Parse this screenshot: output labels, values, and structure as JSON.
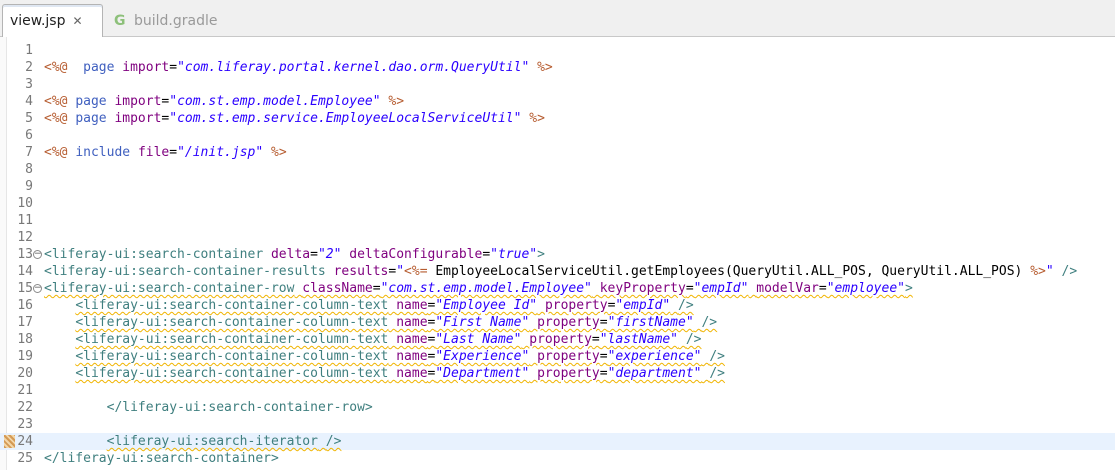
{
  "tabs": [
    {
      "label": "view.jsp",
      "close": "✕",
      "active": true
    },
    {
      "label": "build.gradle",
      "icon": "G",
      "active": false
    }
  ],
  "current_line": 24,
  "colors": {
    "directive": "#b65c30",
    "keyword": "#3f5fbf",
    "tag": "#3f7f7f",
    "attribute": "#7f007f",
    "value": "#2a00ff",
    "current_line_bg": "#e8f2fe",
    "warning_underline": "#f0b400"
  },
  "lines": [
    {
      "n": 1,
      "tokens": []
    },
    {
      "n": 2,
      "tokens": [
        [
          "dir",
          "<%@"
        ],
        [
          "",
          "  "
        ],
        [
          "kw",
          "page"
        ],
        [
          "",
          " "
        ],
        [
          "attr",
          "import"
        ],
        [
          "",
          "="
        ],
        [
          "val",
          "\"com.liferay.portal.kernel.dao.orm.QueryUtil\""
        ],
        [
          "",
          " "
        ],
        [
          "dir",
          "%>"
        ]
      ]
    },
    {
      "n": 3,
      "tokens": []
    },
    {
      "n": 4,
      "tokens": [
        [
          "dir",
          "<%@"
        ],
        [
          "",
          " "
        ],
        [
          "kw",
          "page"
        ],
        [
          "",
          " "
        ],
        [
          "attr",
          "import"
        ],
        [
          "",
          "="
        ],
        [
          "val",
          "\"com.st.emp.model.Employee\""
        ],
        [
          "",
          " "
        ],
        [
          "dir",
          "%>"
        ]
      ]
    },
    {
      "n": 5,
      "tokens": [
        [
          "dir",
          "<%@"
        ],
        [
          "",
          " "
        ],
        [
          "kw",
          "page"
        ],
        [
          "",
          " "
        ],
        [
          "attr",
          "import"
        ],
        [
          "",
          "="
        ],
        [
          "val",
          "\"com.st.emp.service.EmployeeLocalServiceUtil\""
        ],
        [
          "",
          " "
        ],
        [
          "dir",
          "%>"
        ]
      ]
    },
    {
      "n": 6,
      "tokens": []
    },
    {
      "n": 7,
      "tokens": [
        [
          "dir",
          "<%@"
        ],
        [
          "",
          " "
        ],
        [
          "kw",
          "include"
        ],
        [
          "",
          " "
        ],
        [
          "attr",
          "file"
        ],
        [
          "",
          "="
        ],
        [
          "val",
          "\"/init.jsp\""
        ],
        [
          "",
          " "
        ],
        [
          "dir",
          "%>"
        ]
      ]
    },
    {
      "n": 8,
      "tokens": []
    },
    {
      "n": 9,
      "tokens": []
    },
    {
      "n": 10,
      "tokens": []
    },
    {
      "n": 11,
      "tokens": []
    },
    {
      "n": 12,
      "tokens": []
    },
    {
      "n": 13,
      "fold": true,
      "tokens": [
        [
          "tag",
          "<liferay-ui:search-container"
        ],
        [
          "",
          " "
        ],
        [
          "attr",
          "delta"
        ],
        [
          "",
          "="
        ],
        [
          "val",
          "\"2\""
        ],
        [
          "",
          " "
        ],
        [
          "attr",
          "deltaConfigurable"
        ],
        [
          "",
          "="
        ],
        [
          "val",
          "\"true\""
        ],
        [
          "tag",
          ">"
        ]
      ]
    },
    {
      "n": 14,
      "tokens": [
        [
          "tag",
          "<liferay-ui:search-container-results"
        ],
        [
          "",
          " "
        ],
        [
          "attr",
          "results"
        ],
        [
          "",
          "="
        ],
        [
          "val",
          "\""
        ],
        [
          "dir",
          "<%="
        ],
        [
          "java",
          " EmployeeLocalServiceUtil.getEmployees(QueryUtil.ALL_POS, QueryUtil.ALL_POS) "
        ],
        [
          "dir",
          "%>"
        ],
        [
          "val",
          "\""
        ],
        [
          "",
          " "
        ],
        [
          "tag",
          "/>"
        ]
      ]
    },
    {
      "n": 15,
      "fold": true,
      "warn": true,
      "tokens": [
        [
          "tag",
          "<liferay-ui:search-container-row"
        ],
        [
          "",
          " "
        ],
        [
          "attr",
          "className"
        ],
        [
          "",
          "="
        ],
        [
          "val",
          "\"com.st.emp.model.Employee\""
        ],
        [
          "",
          " "
        ],
        [
          "attr",
          "keyProperty"
        ],
        [
          "",
          "="
        ],
        [
          "val",
          "\"empId\""
        ],
        [
          "",
          " "
        ],
        [
          "attr",
          "modelVar"
        ],
        [
          "",
          "="
        ],
        [
          "val",
          "\"employee\""
        ],
        [
          "tag",
          ">"
        ]
      ]
    },
    {
      "n": 16,
      "warn": true,
      "tokens": [
        [
          "",
          "    "
        ],
        [
          "tag",
          "<liferay-ui:search-container-column-text"
        ],
        [
          "",
          " "
        ],
        [
          "attr",
          "name"
        ],
        [
          "",
          "="
        ],
        [
          "val",
          "\"Employee Id\""
        ],
        [
          "",
          " "
        ],
        [
          "attr",
          "property"
        ],
        [
          "",
          "="
        ],
        [
          "val",
          "\"empId\""
        ],
        [
          "",
          " "
        ],
        [
          "tag",
          "/>"
        ]
      ]
    },
    {
      "n": 17,
      "warn": true,
      "tokens": [
        [
          "",
          "    "
        ],
        [
          "tag",
          "<liferay-ui:search-container-column-text"
        ],
        [
          "",
          " "
        ],
        [
          "attr",
          "name"
        ],
        [
          "",
          "="
        ],
        [
          "val",
          "\"First Name\""
        ],
        [
          "",
          " "
        ],
        [
          "attr",
          "property"
        ],
        [
          "",
          "="
        ],
        [
          "val",
          "\"firstName\""
        ],
        [
          "",
          " "
        ],
        [
          "tag",
          "/>"
        ]
      ]
    },
    {
      "n": 18,
      "warn": true,
      "tokens": [
        [
          "",
          "    "
        ],
        [
          "tag",
          "<liferay-ui:search-container-column-text"
        ],
        [
          "",
          " "
        ],
        [
          "attr",
          "name"
        ],
        [
          "",
          "="
        ],
        [
          "val",
          "\"Last Name\""
        ],
        [
          "",
          " "
        ],
        [
          "attr",
          "property"
        ],
        [
          "",
          "="
        ],
        [
          "val",
          "\"lastName\""
        ],
        [
          "",
          " "
        ],
        [
          "tag",
          "/>"
        ]
      ]
    },
    {
      "n": 19,
      "warn": true,
      "tokens": [
        [
          "",
          "    "
        ],
        [
          "tag",
          "<liferay-ui:search-container-column-text"
        ],
        [
          "",
          " "
        ],
        [
          "attr",
          "name"
        ],
        [
          "",
          "="
        ],
        [
          "val",
          "\"Experience\""
        ],
        [
          "",
          " "
        ],
        [
          "attr",
          "property"
        ],
        [
          "",
          "="
        ],
        [
          "val",
          "\"experience\""
        ],
        [
          "",
          " "
        ],
        [
          "tag",
          "/>"
        ]
      ]
    },
    {
      "n": 20,
      "warn": true,
      "tokens": [
        [
          "",
          "    "
        ],
        [
          "tag",
          "<liferay-ui:search-container-column-text"
        ],
        [
          "",
          " "
        ],
        [
          "attr",
          "name"
        ],
        [
          "",
          "="
        ],
        [
          "val",
          "\"Department\""
        ],
        [
          "",
          " "
        ],
        [
          "attr",
          "property"
        ],
        [
          "",
          "="
        ],
        [
          "val",
          "\"department\""
        ],
        [
          "",
          " "
        ],
        [
          "tag",
          "/>"
        ]
      ]
    },
    {
      "n": 21,
      "tokens": []
    },
    {
      "n": 22,
      "tokens": [
        [
          "",
          "        "
        ],
        [
          "tag",
          "</liferay-ui:search-container-row>"
        ]
      ]
    },
    {
      "n": 23,
      "tokens": []
    },
    {
      "n": 24,
      "marker": true,
      "warn": true,
      "tokens": [
        [
          "",
          "        "
        ],
        [
          "tag",
          "<liferay-ui:search-iterator"
        ],
        [
          "",
          " "
        ],
        [
          "tag",
          "/>"
        ]
      ]
    },
    {
      "n": 25,
      "tokens": [
        [
          "tag",
          "</liferay-ui:search-container>"
        ]
      ]
    }
  ]
}
